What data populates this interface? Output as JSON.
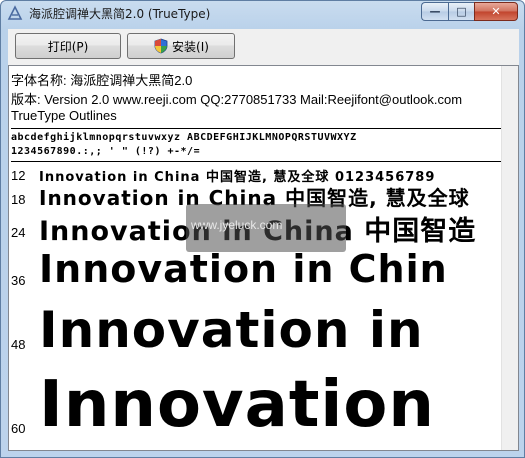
{
  "window": {
    "title": "海派腔调禅大黑简2.0 (TrueType)",
    "buttons": {
      "minimize": "—",
      "maximize": "□",
      "close": "✕"
    }
  },
  "toolbar": {
    "print_label": "打印(P)",
    "install_label": "安装(I)"
  },
  "font_info": {
    "name_line": "字体名称: 海派腔调禅大黑简2.0",
    "version_line": "版本: Version 2.0  www.reeji.com QQ:2770851733  Mail:Reejifont@outlook.com",
    "type_line": "TrueType Outlines"
  },
  "charset": {
    "line1": "abcdefghijklmnopqrstuvwxyz ABCDEFGHIJKLMNOPQRSTUVWXYZ",
    "line2": "1234567890.:,; ' \" (!?) +-*/="
  },
  "samples": [
    {
      "size": "12",
      "text": "Innovation in China 中国智造, 慧及全球 0123456789"
    },
    {
      "size": "18",
      "text": "Innovation in China 中国智造, 慧及全球"
    },
    {
      "size": "24",
      "text": "Innovation in China 中国智造"
    },
    {
      "size": "36",
      "text": "Innovation in Chin"
    },
    {
      "size": "48",
      "text": "Innovation in"
    },
    {
      "size": "60",
      "text": "Innovation"
    }
  ],
  "watermark": "www.jyeluck.com",
  "colors": {
    "titlebar": "#b9d1ea",
    "close": "#c1432c",
    "content_bg": "#ffffff"
  }
}
